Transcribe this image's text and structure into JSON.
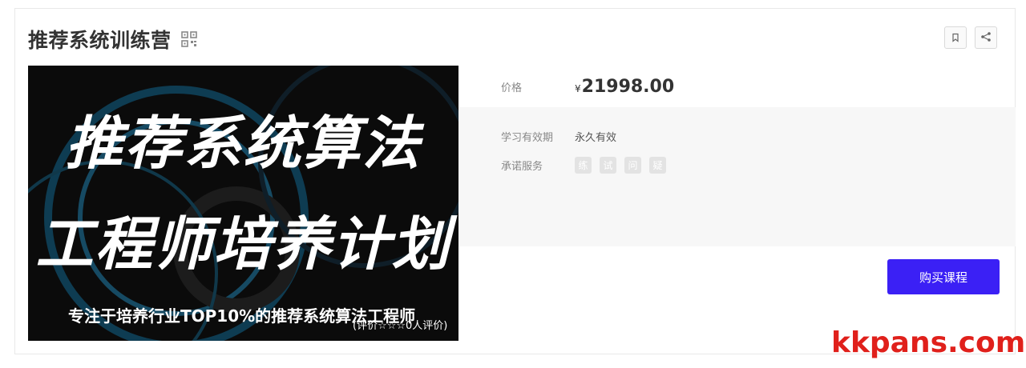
{
  "header": {
    "title": "推荐系统训练营",
    "qr_icon": "qrcode-icon",
    "actions": [
      {
        "icon": "bookmark-icon"
      },
      {
        "icon": "share-icon"
      }
    ]
  },
  "cover": {
    "line1": "推荐系统算法",
    "line2": "工程师培养计划",
    "subtitle": "专注于培养行业TOP10%的推荐系统算法工程师",
    "rating": "(评价☆☆☆0人评价)"
  },
  "details": {
    "price_label": "价格",
    "price_symbol": "¥",
    "price": "21998.00",
    "validity_label": "学习有效期",
    "validity_value": "永久有效",
    "service_label": "承诺服务",
    "services": [
      "练",
      "试",
      "问",
      "疑"
    ]
  },
  "buy_button": "购买课程",
  "watermark": "kkpans.com",
  "colors": {
    "accent": "#3b20f5",
    "watermark": "#e0201b"
  }
}
